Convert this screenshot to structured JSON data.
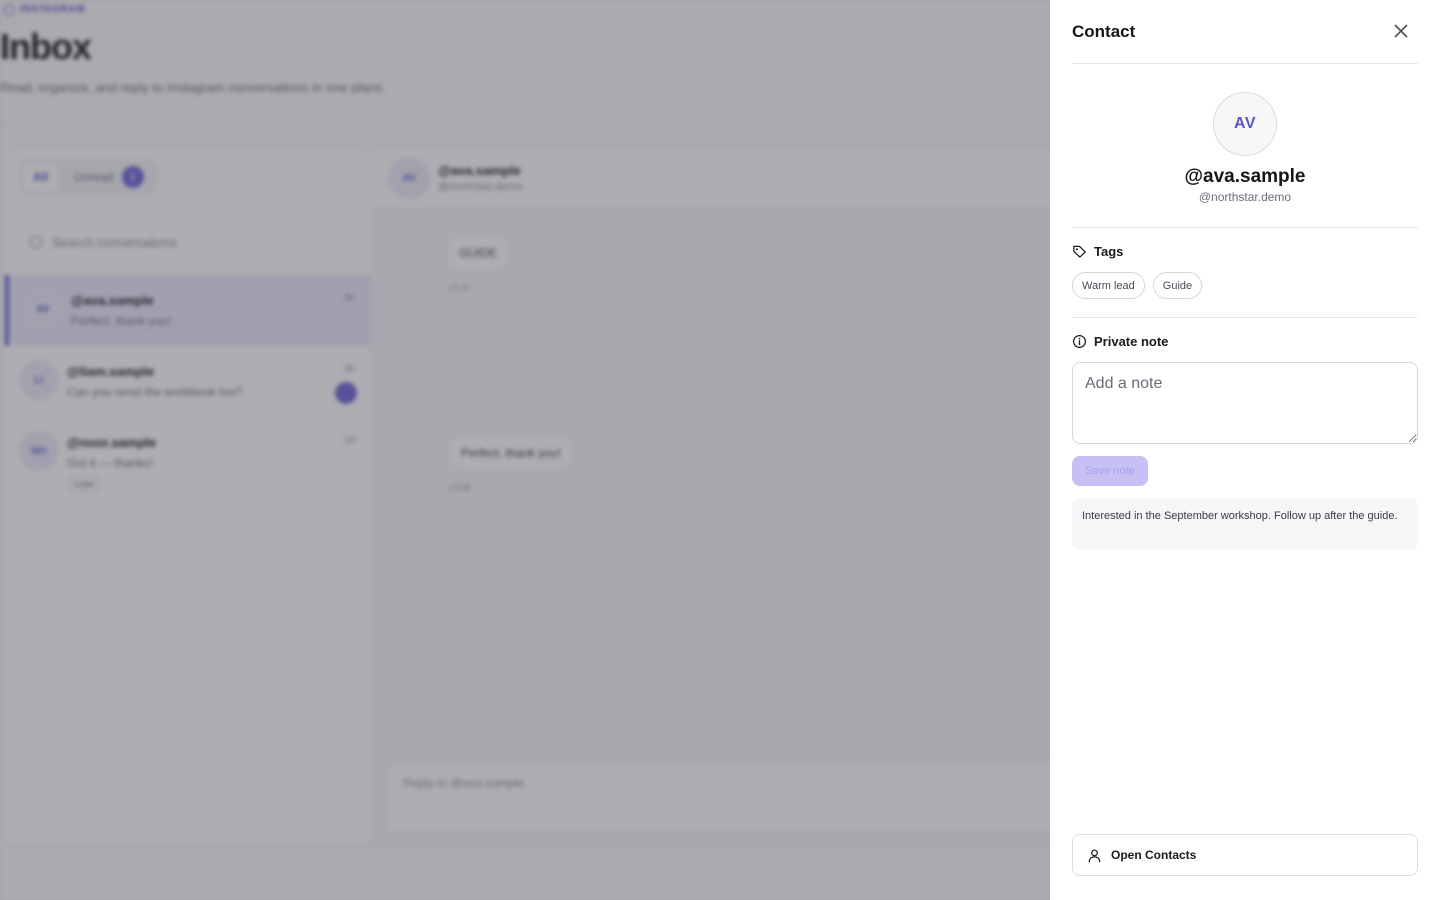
{
  "app": {
    "eyebrow": "INSTAGRAM",
    "title": "Inbox",
    "subtitle": "Read, organize, and reply to Instagram conversations in one place."
  },
  "filters": {
    "all_label": "All",
    "unread_label": "Unread",
    "unread_count": "1"
  },
  "search": {
    "placeholder": "Search conversations"
  },
  "conversations": [
    {
      "initials": "AV",
      "handle": "@ava.sample",
      "preview": "Perfect, thank you!",
      "time": "3h",
      "selected": true,
      "unread": false
    },
    {
      "initials": "LI",
      "handle": "@liam.sample",
      "preview": "Can you send the workbook too?",
      "time": "3h",
      "selected": false,
      "unread": true
    },
    {
      "initials": "NO",
      "handle": "@noor.sample",
      "preview": "Got it — thanks!",
      "time": "1d",
      "selected": false,
      "unread": false,
      "tag": "Lead"
    }
  ],
  "thread": {
    "initials": "AV",
    "handle": "@ava.sample",
    "account": "@northstar.demo",
    "messages": [
      {
        "text": "GUIDE",
        "time": "15:47"
      },
      {
        "text": "Perfect, thank you!",
        "time": "15:58"
      }
    ],
    "composer_placeholder": "Reply to @ava.sample"
  },
  "drawer": {
    "title": "Contact",
    "avatar_initials": "AV",
    "handle": "@ava.sample",
    "account": "@northstar.demo",
    "tags_heading": "Tags",
    "tags": [
      "Warm lead",
      "Guide"
    ],
    "note_heading": "Private note",
    "note_placeholder": "Add a note",
    "note_value": "",
    "save_label": "Save note",
    "saved_note": "Interested in the September workshop. Follow up after the guide.",
    "open_contacts_label": "Open Contacts"
  },
  "colors": {
    "accent": "#6c63d8",
    "accent_disabled": "#c6c0f5",
    "overlay": "rgba(60,60,72,0.42)"
  }
}
